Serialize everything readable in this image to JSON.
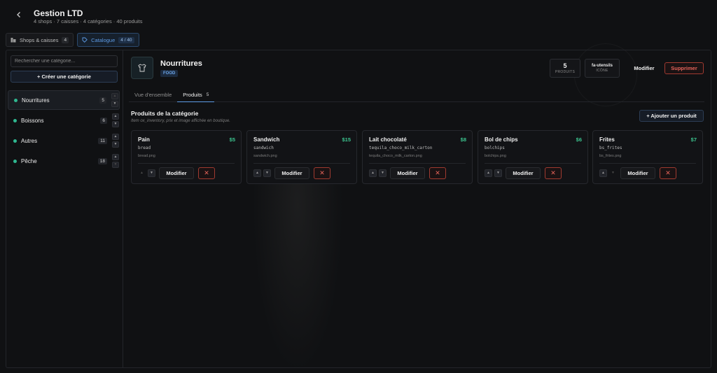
{
  "header": {
    "back_icon": "chevron-left-icon",
    "title": "Gestion LTD",
    "subtitle": "4 shops · 7 caisses · 4 catégories · 40 produits"
  },
  "top_tabs": [
    {
      "label": "Shops & caisses",
      "count": "4",
      "icon": "store-icon",
      "active": false
    },
    {
      "label": "Catalogue",
      "count": "4 / 40",
      "icon": "tag-icon",
      "active": true
    }
  ],
  "sidebar": {
    "search_placeholder": "Rechercher une catégorie...",
    "create_label": "+ Créer une catégorie",
    "categories": [
      {
        "label": "Nourritures",
        "count": "5"
      },
      {
        "label": "Boissons",
        "count": "6"
      },
      {
        "label": "Autres",
        "count": "11"
      },
      {
        "label": "Pêche",
        "count": "18"
      }
    ]
  },
  "category": {
    "icon": "shirt-icon",
    "title": "Nourritures",
    "tag": "FOOD",
    "stats": {
      "products_value": "5",
      "products_label": "PRODUITS",
      "icon_value": "fa-utensils",
      "icon_label": "ICÔNE"
    },
    "modify_label": "Modifier",
    "delete_label": "Supprimer"
  },
  "sub_tabs": [
    {
      "label": "Vue d'ensemble",
      "count": ""
    },
    {
      "label": "Produits",
      "count": "5"
    }
  ],
  "products_section": {
    "title": "Produits de la catégorie",
    "subtitle": "Item ox_inventory, prix et image affichée en boutique.",
    "add_label": "+ Ajouter un produit"
  },
  "products": [
    {
      "name": "Pain",
      "price": "$5",
      "item": "bread",
      "image": "bread.png",
      "modify": "Modifier"
    },
    {
      "name": "Sandwich",
      "price": "$15",
      "item": "sandwich",
      "image": "sandwich.png",
      "modify": "Modifier"
    },
    {
      "name": "Lait chocolaté",
      "price": "$8",
      "item": "tequila_choco_milk_carton",
      "image": "tequila_choco_milk_carton.png",
      "modify": "Modifier"
    },
    {
      "name": "Bol de chips",
      "price": "$6",
      "item": "bolchips",
      "image": "bolchips.png",
      "modify": "Modifier"
    },
    {
      "name": "Frites",
      "price": "$7",
      "item": "bs_frites",
      "image": "bs_frites.png",
      "modify": "Modifier"
    }
  ],
  "colors": {
    "accent": "#5d9be6",
    "price": "#3cc48f",
    "danger": "#e6645a",
    "dot": "#2fb890"
  }
}
